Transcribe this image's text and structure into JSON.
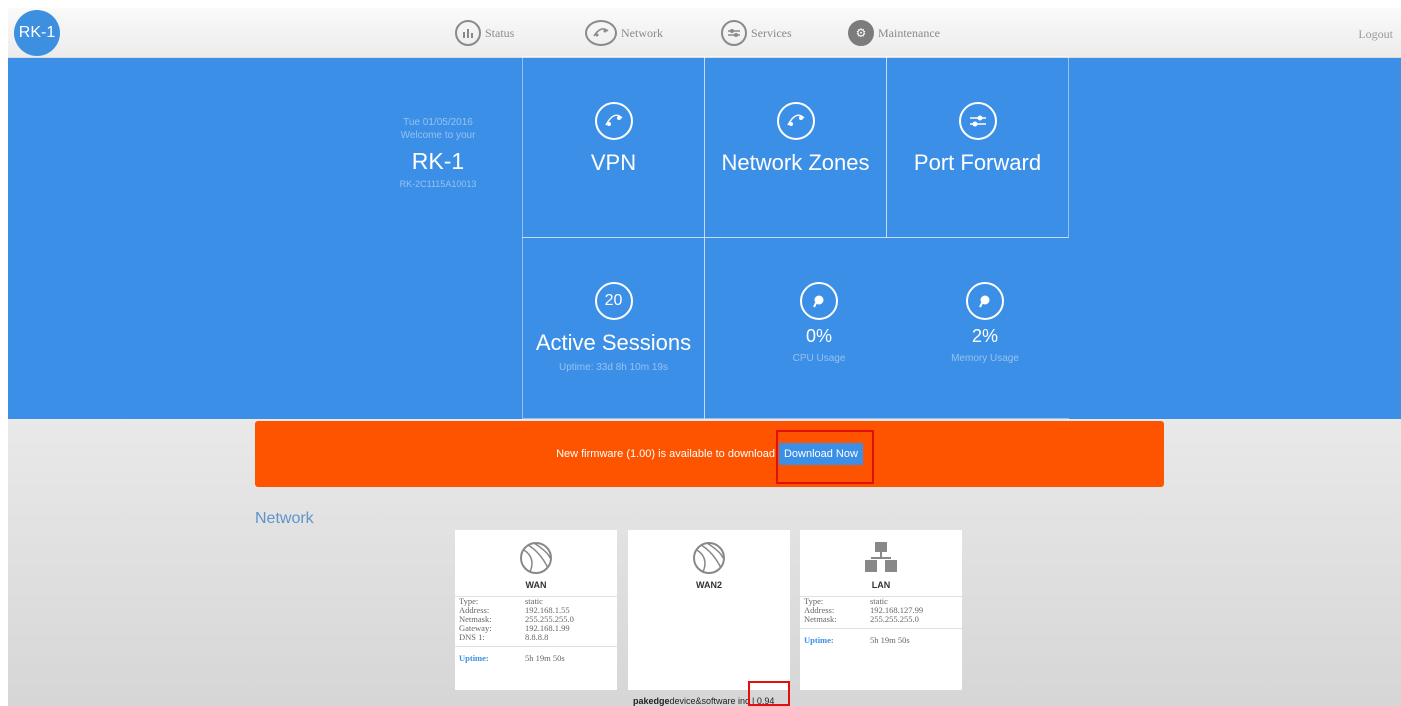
{
  "header": {
    "logo": "RK-1",
    "nav": [
      {
        "label": "Status",
        "icon": "bar-chart-icon"
      },
      {
        "label": "Network",
        "icon": "network-icon"
      },
      {
        "label": "Services",
        "icon": "services-icon"
      },
      {
        "label": "Maintenance",
        "icon": "gear-icon"
      }
    ],
    "logout": "Logout"
  },
  "welcome": {
    "date": "Tue 01/05/2016",
    "greeting": "Welcome to your",
    "device_name": "RK-1",
    "serial": "RK-2C1115A10013"
  },
  "tiles": {
    "vpn": {
      "label": "VPN"
    },
    "network_zones": {
      "label": "Network Zones"
    },
    "port_forward": {
      "label": "Port Forward"
    },
    "sessions": {
      "count": "20",
      "label": "Active Sessions",
      "uptime": "Uptime: 33d 8h 10m 19s"
    },
    "cpu": {
      "value": "0%",
      "label": "CPU Usage"
    },
    "memory": {
      "value": "2%",
      "label": "Memory Usage"
    }
  },
  "firmware": {
    "message": "New firmware (1.00) is available to download",
    "button": "Download Now"
  },
  "network": {
    "title": "Network",
    "cards": [
      {
        "title": "WAN",
        "rows": [
          [
            "Type:",
            "static"
          ],
          [
            "Address:",
            "192.168.1.55"
          ],
          [
            "Netmask:",
            "255.255.255.0"
          ],
          [
            "Gateway:",
            "192.168.1.99"
          ],
          [
            "DNS 1:",
            "8.8.8.8"
          ]
        ],
        "uptime_label": "Uptime:",
        "uptime": "5h 19m 50s"
      },
      {
        "title": "WAN2"
      },
      {
        "title": "LAN",
        "rows": [
          [
            "Type:",
            "static"
          ],
          [
            "Address:",
            "192.168.127.99"
          ],
          [
            "Netmask:",
            "255.255.255.0"
          ]
        ],
        "uptime_label": "Uptime:",
        "uptime": "5h 19m 50s"
      }
    ]
  },
  "footer": {
    "brand": "pakedge",
    "text": "device&software inc | 0.94"
  },
  "colors": {
    "primary": "#3c8fe6",
    "alert": "#fe5400",
    "highlight": "#e01010"
  }
}
